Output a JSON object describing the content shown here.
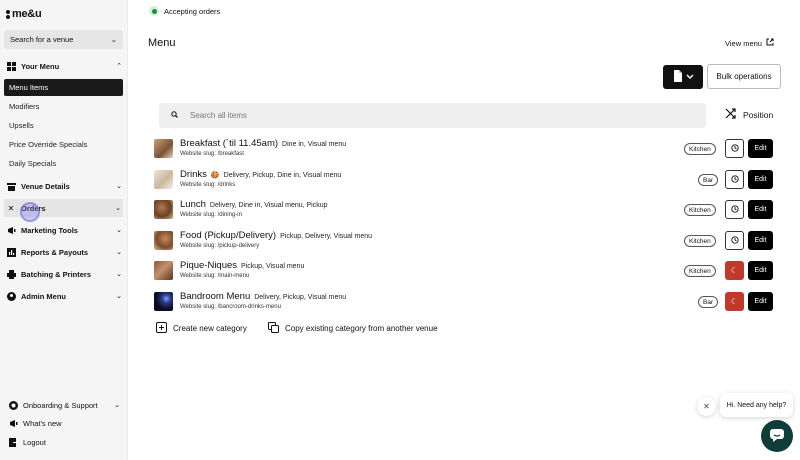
{
  "brand": {
    "logo_text": "me&u"
  },
  "sidebar": {
    "venue_search": "Search for a venue",
    "groups": [
      {
        "label": "Your Menu",
        "icon": "grid-icon",
        "expanded": true
      },
      {
        "label": "Venue Details",
        "icon": "store-icon"
      },
      {
        "label": "Orders",
        "icon": "utensils-icon"
      },
      {
        "label": "Marketing Tools",
        "icon": "megaphone-icon"
      },
      {
        "label": "Reports & Payouts",
        "icon": "chart-icon"
      },
      {
        "label": "Batching & Printers",
        "icon": "printer-icon"
      },
      {
        "label": "Admin Menu",
        "icon": "admin-icon"
      }
    ],
    "menu_items": [
      "Menu Items",
      "Modifiers",
      "Upsells",
      "Price Override Specials",
      "Daily Specials"
    ],
    "bottom": [
      {
        "label": "Onboarding & Support",
        "icon": "support-icon"
      },
      {
        "label": "What's new",
        "icon": "megaphone-icon"
      },
      {
        "label": "Logout",
        "icon": "logout-icon"
      }
    ]
  },
  "header": {
    "status": "Accepting orders",
    "title": "Menu",
    "view_menu": "View menu",
    "bulk_operations": "Bulk operations",
    "search_placeholder": "Search all items",
    "position": "Position"
  },
  "categories": [
    {
      "name": "Breakfast (`til 11.45am)",
      "emoji": "",
      "tags": "Dine in, Visual menu",
      "slug": "Website slug: /breakfast",
      "station": "Kitchen",
      "state": "clock"
    },
    {
      "name": "Drinks",
      "emoji": "🍪",
      "tags": "Delivery, Pickup, Dine in, Visual menu",
      "slug": "Website slug: /drinks",
      "station": "Bar",
      "state": "clock"
    },
    {
      "name": "Lunch",
      "emoji": "",
      "tags": "Delivery, Dine in, Visual menu, Pickup",
      "slug": "Website slug: /dining-in",
      "station": "Kitchen",
      "state": "clock"
    },
    {
      "name": "Food (Pickup/Delivery)",
      "emoji": "",
      "tags": "Pickup, Delivery, Visual menu",
      "slug": "Website slug: /pickup-delivery",
      "station": "Kitchen",
      "state": "clock"
    },
    {
      "name": "Pique-Niques",
      "emoji": "",
      "tags": "Pickup, Visual menu",
      "slug": "Website slug: /main-menu",
      "station": "Kitchen",
      "state": "moon"
    },
    {
      "name": "Bandroom Menu",
      "emoji": "",
      "tags": "Delivery, Pickup, Visual menu",
      "slug": "Website slug: /bancroom-drinks-menu",
      "station": "Bar",
      "state": "moon"
    }
  ],
  "row_edit_label": "Edit",
  "actions": {
    "create_category": "Create new category",
    "copy_category": "Copy existing category from another venue"
  },
  "help": {
    "text": "Hi. Need any help?"
  },
  "colors": {
    "accent_dark": "#111111",
    "inactive_red": "#c0392b",
    "status_green": "#1e8e3e",
    "chat_teal": "#0f3d3a"
  }
}
